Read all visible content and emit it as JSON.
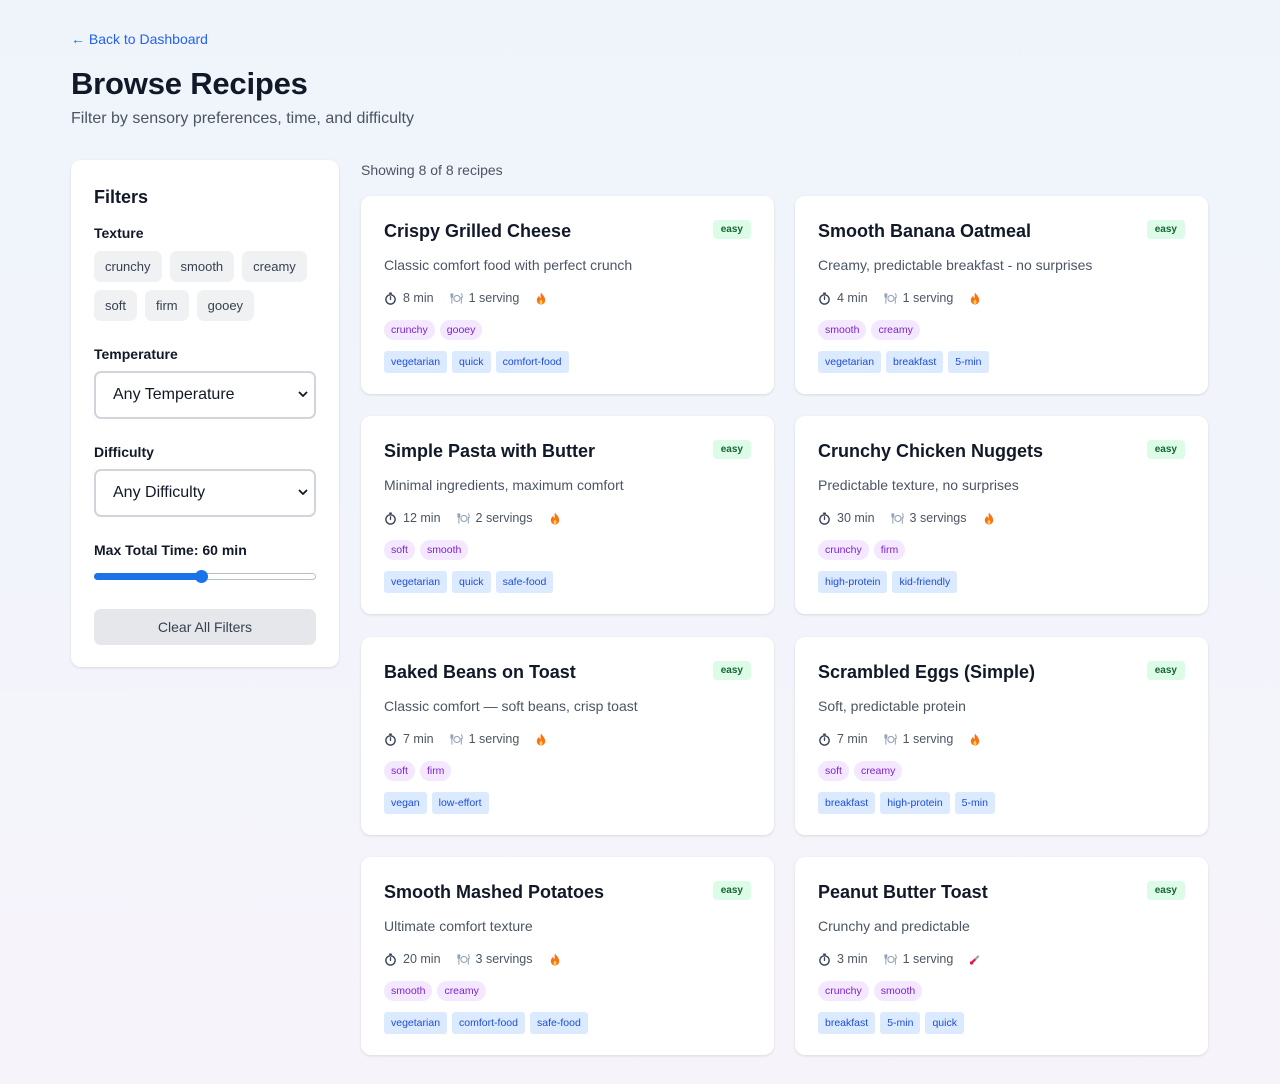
{
  "nav": {
    "back_label": "← Back to Dashboard"
  },
  "header": {
    "title": "Browse Recipes",
    "subtitle": "Filter by sensory preferences, time, and difficulty"
  },
  "filters": {
    "title": "Filters",
    "texture_label": "Texture",
    "texture_row1": [
      "crunchy",
      "smooth",
      "creamy"
    ],
    "texture_row2": [
      "soft",
      "firm",
      "gooey"
    ],
    "temperature_label": "Temperature",
    "temperature_value": "Any Temperature",
    "difficulty_label": "Difficulty",
    "difficulty_value": "Any Difficulty",
    "max_time_label": "Max Total Time: 60 min",
    "max_time_fraction": 0.48,
    "clear_label": "Clear All Filters"
  },
  "results": {
    "count_text": "Showing 8 of 8 recipes",
    "recipes": [
      {
        "title": "Crispy Grilled Cheese",
        "difficulty": "easy",
        "desc": "Classic comfort food with perfect crunch",
        "time": "8 min",
        "servings": "1 serving",
        "temp_icon": "flame-icon",
        "textures": [
          "crunchy",
          "gooey"
        ],
        "tags": [
          "vegetarian",
          "quick",
          "comfort-food"
        ]
      },
      {
        "title": "Smooth Banana Oatmeal",
        "difficulty": "easy",
        "desc": "Creamy, predictable breakfast - no surprises",
        "time": "4 min",
        "servings": "1 serving",
        "temp_icon": "flame-icon",
        "textures": [
          "smooth",
          "creamy"
        ],
        "tags": [
          "vegetarian",
          "breakfast",
          "5-min"
        ]
      },
      {
        "title": "Simple Pasta with Butter",
        "difficulty": "easy",
        "desc": "Minimal ingredients, maximum comfort",
        "time": "12 min",
        "servings": "2 servings",
        "temp_icon": "flame-icon",
        "textures": [
          "soft",
          "smooth"
        ],
        "tags": [
          "vegetarian",
          "quick",
          "safe-food"
        ]
      },
      {
        "title": "Crunchy Chicken Nuggets",
        "difficulty": "easy",
        "desc": "Predictable texture, no surprises",
        "time": "30 min",
        "servings": "3 servings",
        "temp_icon": "flame-icon",
        "textures": [
          "crunchy",
          "firm"
        ],
        "tags": [
          "high-protein",
          "kid-friendly"
        ]
      },
      {
        "title": "Baked Beans on Toast",
        "difficulty": "easy",
        "desc": "Classic comfort — soft beans, crisp toast",
        "time": "7 min",
        "servings": "1 serving",
        "temp_icon": "flame-icon",
        "textures": [
          "soft",
          "firm"
        ],
        "tags": [
          "vegan",
          "low-effort"
        ]
      },
      {
        "title": "Scrambled Eggs (Simple)",
        "difficulty": "easy",
        "desc": "Soft, predictable protein",
        "time": "7 min",
        "servings": "1 serving",
        "temp_icon": "flame-icon",
        "textures": [
          "soft",
          "creamy"
        ],
        "tags": [
          "breakfast",
          "high-protein",
          "5-min"
        ]
      },
      {
        "title": "Smooth Mashed Potatoes",
        "difficulty": "easy",
        "desc": "Ultimate comfort texture",
        "time": "20 min",
        "servings": "3 servings",
        "temp_icon": "flame-icon",
        "textures": [
          "smooth",
          "creamy"
        ],
        "tags": [
          "vegetarian",
          "comfort-food",
          "safe-food"
        ]
      },
      {
        "title": "Peanut Butter Toast",
        "difficulty": "easy",
        "desc": "Crunchy and predictable",
        "time": "3 min",
        "servings": "1 serving",
        "temp_icon": "thermometer-icon",
        "textures": [
          "crunchy",
          "smooth"
        ],
        "tags": [
          "breakfast",
          "5-min",
          "quick"
        ]
      }
    ]
  },
  "colors": {
    "accent": "#2563eb",
    "slider": "#1a73e8",
    "badge_bg": "#dcfce7",
    "badge_text": "#166534",
    "texture_bg": "#f3e8ff",
    "texture_text": "#7e22ce",
    "tag_bg": "#dbeafe",
    "tag_text": "#1d4ed8"
  }
}
